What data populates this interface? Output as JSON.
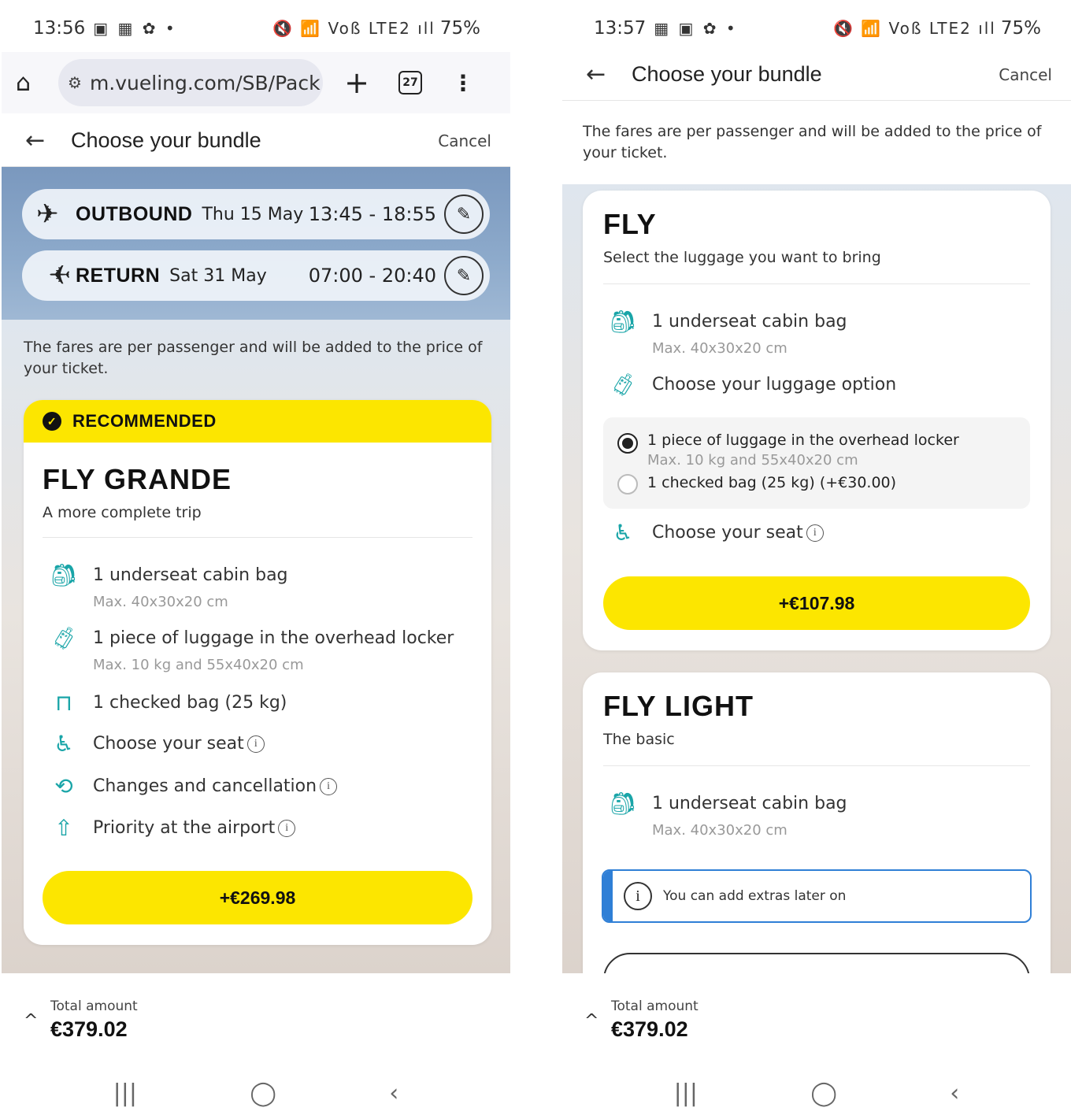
{
  "left": {
    "status": {
      "time": "13:56",
      "left_icons": "▣ ▦ ✿ •",
      "right_icons": "🔇 📶 Voß LTE2 ıll",
      "battery": "75%"
    },
    "browser": {
      "url": "m.vueling.com/SB/Pack",
      "tab_count": "27"
    },
    "header": {
      "title": "Choose your bundle",
      "cancel": "Cancel"
    },
    "flights": [
      {
        "direction": "OUTBOUND",
        "date": "Thu 15 May",
        "times": "13:45 - 18:55"
      },
      {
        "direction": "RETURN",
        "date": "Sat 31 May",
        "times": "07:00 - 20:40"
      }
    ],
    "note": "The fares are per passenger and will be added to the price of your ticket.",
    "card": {
      "badge": "RECOMMENDED",
      "name": "FLY GRANDE",
      "subtitle": "A more complete trip",
      "features": [
        {
          "icon": "backpack-icon",
          "label": "1 underseat cabin bag",
          "sub": "Max. 40x30x20 cm"
        },
        {
          "icon": "trolley-icon",
          "label": "1 piece of luggage in the overhead locker",
          "sub": "Max. 10 kg and 55x40x20 cm"
        },
        {
          "icon": "suitcase-icon",
          "label": "1 checked bag (25 kg)"
        },
        {
          "icon": "seat-icon",
          "label": "Choose your seat"
        },
        {
          "icon": "change-icon",
          "label": "Changes and cancellation"
        },
        {
          "icon": "priority-icon",
          "label": "Priority at the airport"
        }
      ],
      "price": "+€269.98"
    },
    "footer": {
      "label": "Total amount",
      "value": "€379.02"
    }
  },
  "right": {
    "status": {
      "time": "13:57",
      "left_icons": "▦ ▣ ✿ •",
      "right_icons": "🔇 📶 Voß LTE2 ıll",
      "battery": "75%"
    },
    "header": {
      "title": "Choose your bundle",
      "cancel": "Cancel"
    },
    "note": "The fares are per passenger and will be added to the price of your ticket.",
    "fly": {
      "name": "FLY",
      "subtitle": "Select the luggage you want to bring",
      "cabin_bag": {
        "label": "1 underseat cabin bag",
        "sub": "Max. 40x30x20 cm"
      },
      "luggage_option_label": "Choose your luggage option",
      "options": [
        {
          "label": "1 piece of luggage in the overhead locker",
          "sub": "Max. 10 kg and 55x40x20 cm",
          "selected": true
        },
        {
          "label": "1 checked bag (25 kg) (+€30.00)",
          "selected": false
        }
      ],
      "seat": "Choose your seat",
      "price": "+€107.98"
    },
    "fly_light": {
      "name": "FLY LIGHT",
      "subtitle": "The basic",
      "cabin_bag": {
        "label": "1 underseat cabin bag",
        "sub": "Max. 40x30x20 cm"
      },
      "info": "You can add extras later on"
    },
    "footer": {
      "label": "Total amount",
      "value": "€379.02"
    }
  },
  "colors": {
    "brand_yellow": "#fce600",
    "accent_teal": "#1aa5a8",
    "info_blue": "#2f7fd6"
  },
  "nav": {
    "recents": "|||",
    "home": "◯",
    "back": "‹"
  }
}
